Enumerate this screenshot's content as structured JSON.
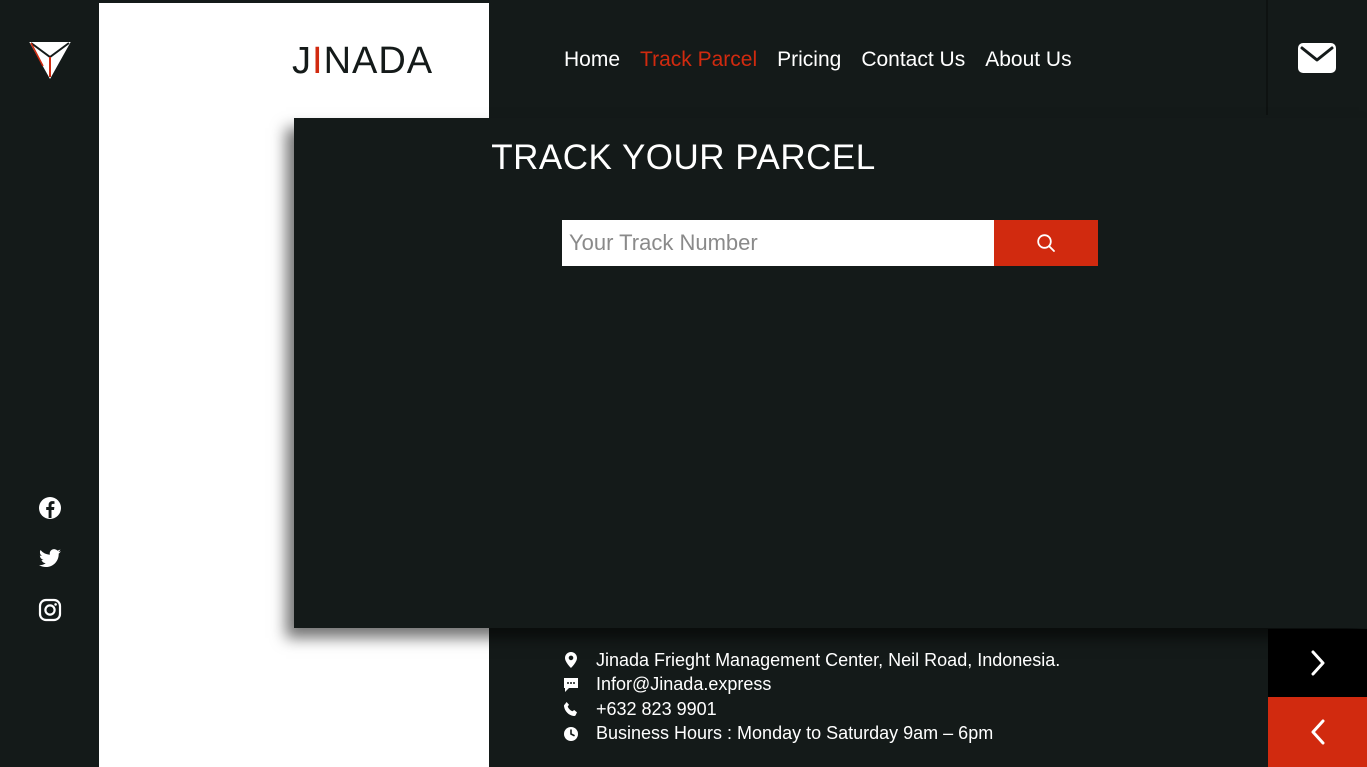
{
  "brand": {
    "prefix": "J",
    "accent": "I",
    "suffix": "NADA"
  },
  "nav": {
    "items": [
      {
        "label": "Home",
        "active": false
      },
      {
        "label": "Track Parcel",
        "active": true
      },
      {
        "label": "Pricing",
        "active": false
      },
      {
        "label": "Contact Us",
        "active": false
      },
      {
        "label": "About Us",
        "active": false
      }
    ]
  },
  "track": {
    "title": "TRACK YOUR PARCEL",
    "placeholder": "Your Track Number",
    "button_icon": "search-icon"
  },
  "social": [
    "facebook-icon",
    "twitter-icon",
    "instagram-icon"
  ],
  "contact": {
    "address": "Jinada Frieght Management Center, Neil Road, Indonesia.",
    "email": "Infor@Jinada.express",
    "phone": "+632 823 9901",
    "hours": "Business Hours : Monday to Saturday 9am – 6pm"
  },
  "colors": {
    "accent": "#d12a0f",
    "dark": "#141a19",
    "white": "#ffffff"
  }
}
